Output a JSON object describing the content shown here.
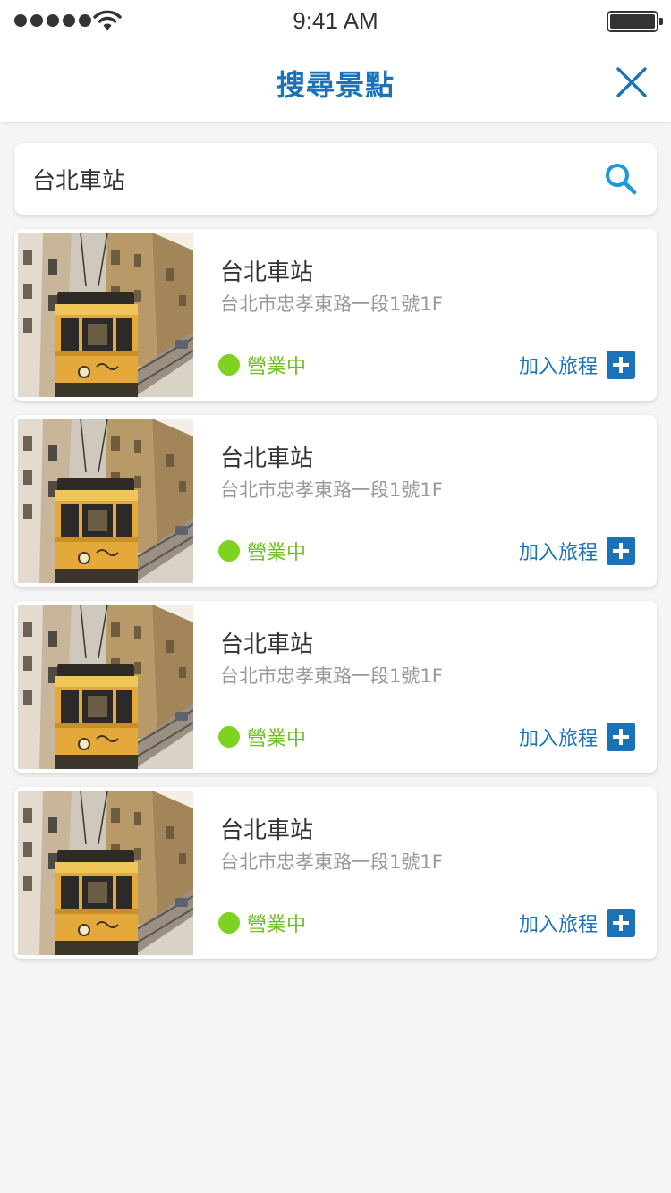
{
  "status_bar": {
    "time": "9:41 AM"
  },
  "header": {
    "title": "搜尋景點"
  },
  "search": {
    "value": "台北車站"
  },
  "results": [
    {
      "name": "台北車站",
      "address": "台北市忠孝東路一段1號1F",
      "status": "營業中",
      "add_label": "加入旅程"
    },
    {
      "name": "台北車站",
      "address": "台北市忠孝東路一段1號1F",
      "status": "營業中",
      "add_label": "加入旅程"
    },
    {
      "name": "台北車站",
      "address": "台北市忠孝東路一段1號1F",
      "status": "營業中",
      "add_label": "加入旅程"
    },
    {
      "name": "台北車站",
      "address": "台北市忠孝東路一段1號1F",
      "status": "營業中",
      "add_label": "加入旅程"
    }
  ],
  "colors": {
    "accent": "#1a73b9",
    "open": "#7ed321",
    "background": "#f5f5f5"
  },
  "icons": {
    "close": "close-icon",
    "search": "search-icon",
    "add": "plus-icon"
  }
}
